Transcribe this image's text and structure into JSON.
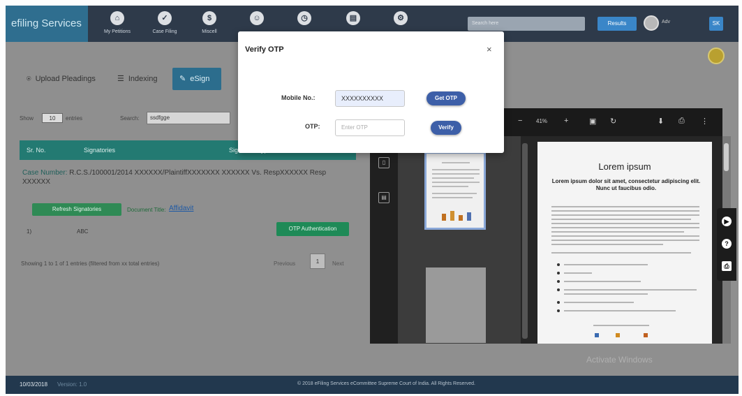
{
  "header": {
    "brand": "efiling Services",
    "nav": [
      {
        "icon": "home-icon",
        "label": "My Petitions"
      },
      {
        "icon": "check-icon",
        "label": "Case Filing"
      },
      {
        "icon": "dollar-icon",
        "label": "Miscell"
      },
      {
        "icon": "group-icon",
        "label": ""
      },
      {
        "icon": "clock-icon",
        "label": ""
      },
      {
        "icon": "doc-icon",
        "label": ""
      },
      {
        "icon": "settings-icon",
        "label": ""
      }
    ],
    "search_placeholder": "Search here",
    "results_label": "Results",
    "avatar_label": "Adv",
    "square_button": "SK"
  },
  "tabs": [
    {
      "label": "Upload Pleadings",
      "icon": "user-icon"
    },
    {
      "label": "Indexing",
      "icon": "list-icon"
    },
    {
      "label": "eSign",
      "icon": "sign-icon",
      "active": true
    }
  ],
  "table_controls": {
    "show_label": "Show",
    "length_value": "10",
    "entries_label": "entries",
    "search_label": "Search:",
    "search_value": "ssdfgge"
  },
  "table": {
    "columns": [
      "Sr. No.",
      "Signatories",
      "Signature Type"
    ],
    "case_prefix": "Case Number:",
    "case_number": "R.C.S./100001/2014 XXXXXX/PlaintiffXXXXXXX XXXXXX",
    "case_vs": "Vs.",
    "case_respondent": "RespXXXXXX Resp XXXXXX",
    "refresh_button": "Refresh Signatories",
    "document_label": "Document Title:",
    "document_link": "Affidavit",
    "row": {
      "sr": "1)",
      "signatory": "ABC",
      "action": "OTP Authentication"
    },
    "showing_text": "Showing 1 to 1 of 1 entries (filtered from xx total entries)",
    "prev_label": "Previous",
    "page": "1",
    "next_label": "Next"
  },
  "pdf_viewer": {
    "zoom": "41%",
    "page_title": "Lorem ipsum",
    "page_subtitle": "Lorem ipsum dolor sit amet, consectetur adipiscing elit. Nunc ut faucibus odio."
  },
  "watermark": "Activate Windows",
  "footer": {
    "date": "10/03/2018",
    "version": "Version: 1.0",
    "copyright": "© 2018 eFiling Services eCommittee Supreme Court of India. All Rights Reserved."
  },
  "modal": {
    "title": "Verify OTP",
    "close": "×",
    "mobile_label": "Mobile No.:",
    "mobile_value": "XXXXXXXXXX",
    "get_otp": "Get OTP",
    "otp_label": "OTP:",
    "otp_placeholder": "Enter OTP",
    "verify": "Verify"
  },
  "colors": {
    "modal_button": "#3d5fa8",
    "table_header": "#237a72",
    "footer": "#22384e"
  }
}
